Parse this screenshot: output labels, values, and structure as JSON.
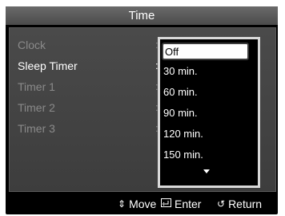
{
  "window": {
    "title": "Time"
  },
  "menu": {
    "items": [
      {
        "label": "Clock",
        "active": false
      },
      {
        "label": "Sleep Timer",
        "active": true
      },
      {
        "label": "Timer 1",
        "active": false
      },
      {
        "label": "Timer 2",
        "active": false
      },
      {
        "label": "Timer 3",
        "active": false
      }
    ],
    "separator": ":"
  },
  "dropdown": {
    "selected": "Off",
    "options": [
      "Off",
      "30 min.",
      "60 min.",
      "90 min.",
      "120 min.",
      "150 min."
    ],
    "more_icon": "triangle-down-icon"
  },
  "footer": {
    "move": {
      "icon": "updown-arrow-icon",
      "label": "Move"
    },
    "enter": {
      "icon": "enter-icon",
      "label": "Enter"
    },
    "return": {
      "icon": "return-icon",
      "label": "Return"
    }
  },
  "colors": {
    "background": "#000000",
    "panel": "#404040",
    "active_text": "#ffffff",
    "inactive_text": "#8a8a8a",
    "highlight": "#ffffff"
  }
}
